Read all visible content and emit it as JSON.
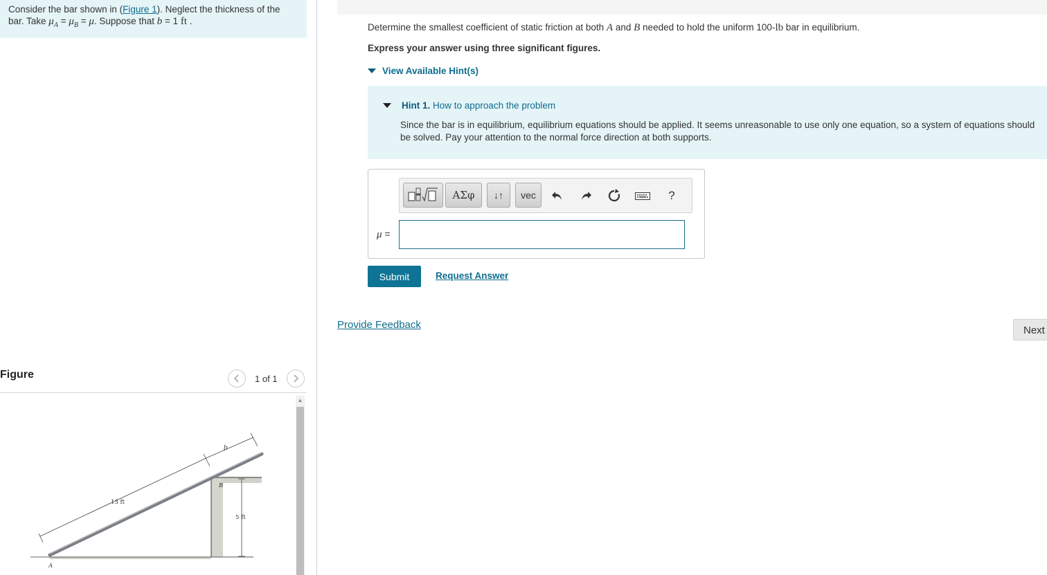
{
  "left": {
    "intro_1": "Consider the bar shown in (",
    "figure_link": "Figure 1",
    "intro_2": "). Neglect the thickness of the",
    "intro_3": "bar. Take ",
    "mu_a": "μ",
    "mu_a_sub": "A",
    "eq1": " = ",
    "mu_b": "μ",
    "mu_b_sub": "B",
    "eq2": " = ",
    "mu": "μ",
    "intro_4": ". Suppose that ",
    "b_var": "b",
    "intro_5": " = 1 ",
    "ft_unit": "ft",
    "intro_6": " ."
  },
  "figure": {
    "header": "Figure",
    "pager": "1 of 1",
    "prev_icon": "chevron-left-icon",
    "next_icon": "chevron-right-icon",
    "label_b": "b",
    "label_13ft": "13 ft",
    "label_5ft": "5 ft",
    "label_B": "B",
    "label_A": "A"
  },
  "question": {
    "text_1": "Determine the smallest coefficient of static friction at both ",
    "var_a": "A",
    "text_2": " and ",
    "var_b": "B",
    "text_3": " needed to hold the uniform 100-",
    "lb": "lb",
    "text_4": " bar in equilibrium.",
    "instruction": "Express your answer using three significant figures.",
    "hints_toggle": "View Available Hint(s)"
  },
  "hint": {
    "label": "Hint 1.",
    "title": "How to approach the problem",
    "body": "Since the bar is in equilibrium, equilibrium equations should be applied. It seems unreasonable to use only one equation, so a system of equations should be solved. Pay your attention to the normal force direction at both supports."
  },
  "answer": {
    "var": "μ",
    "eq": " =",
    "value": "",
    "toolbar": {
      "templates_icon": "fraction-sqrt-templates-icon",
      "greek": "ΑΣφ",
      "arrows": "↓↑",
      "vec": "vec",
      "undo_icon": "undo-icon",
      "redo_icon": "redo-icon",
      "reset_icon": "reset-icon",
      "keyboard_icon": "keyboard-icon",
      "help": "?"
    }
  },
  "actions": {
    "submit": "Submit",
    "request": "Request Answer",
    "feedback": "Provide Feedback",
    "next": "Next"
  }
}
